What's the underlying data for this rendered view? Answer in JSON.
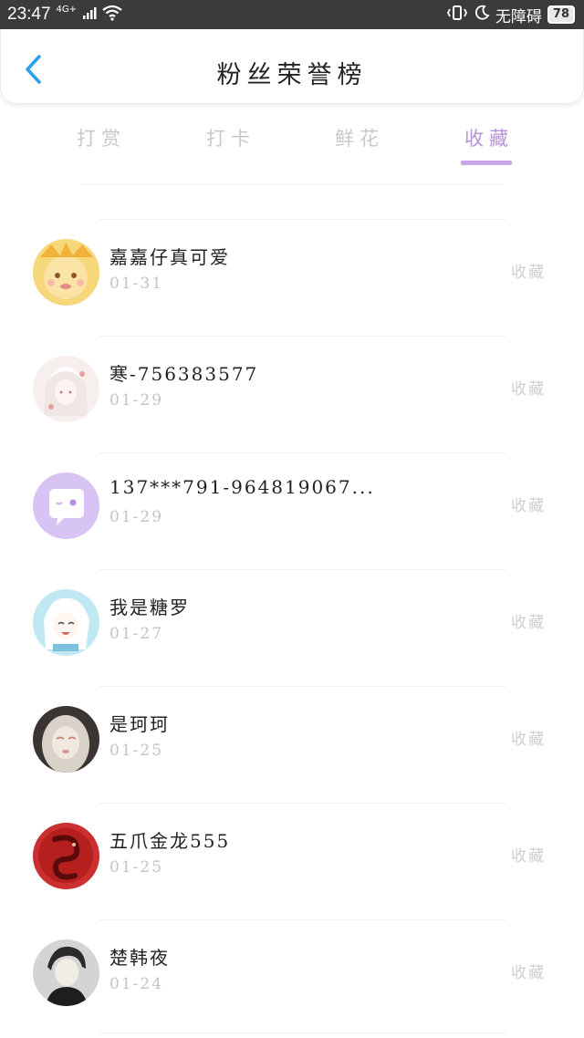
{
  "status_bar": {
    "time": "23:47",
    "network": "4G+",
    "no_disturb_text": "无障碍",
    "battery": "78"
  },
  "header": {
    "title": "粉丝荣誉榜",
    "back_icon": "chevron-left-icon"
  },
  "tabs": [
    {
      "label": "打赏",
      "active": false
    },
    {
      "label": "打卡",
      "active": false
    },
    {
      "label": "鲜花",
      "active": false
    },
    {
      "label": "收藏",
      "active": true
    }
  ],
  "colors": {
    "accent": "#b793d8",
    "indicator": "#c9a6e8",
    "back_arrow": "#2d9ee8",
    "muted_text": "#c3c3c3"
  },
  "fans": [
    {
      "name": "嘉嘉仔真可爱",
      "date": "01-31",
      "action": "收藏",
      "avatar": "yellow-cartoon-avatar"
    },
    {
      "name": "寒-756383577",
      "date": "01-29",
      "action": "收藏",
      "avatar": "pale-anime-avatar"
    },
    {
      "name": "137***791-964819067...",
      "date": "01-29",
      "action": "收藏",
      "avatar": "default-chat-avatar"
    },
    {
      "name": "我是糖罗",
      "date": "01-27",
      "action": "收藏",
      "avatar": "white-hair-anime-avatar"
    },
    {
      "name": "是珂珂",
      "date": "01-25",
      "action": "收藏",
      "avatar": "sketch-girl-avatar"
    },
    {
      "name": "五爪金龙555",
      "date": "01-25",
      "action": "收藏",
      "avatar": "red-dragon-avatar"
    },
    {
      "name": "楚韩夜",
      "date": "01-24",
      "action": "收藏",
      "avatar": "dark-portrait-avatar"
    }
  ]
}
